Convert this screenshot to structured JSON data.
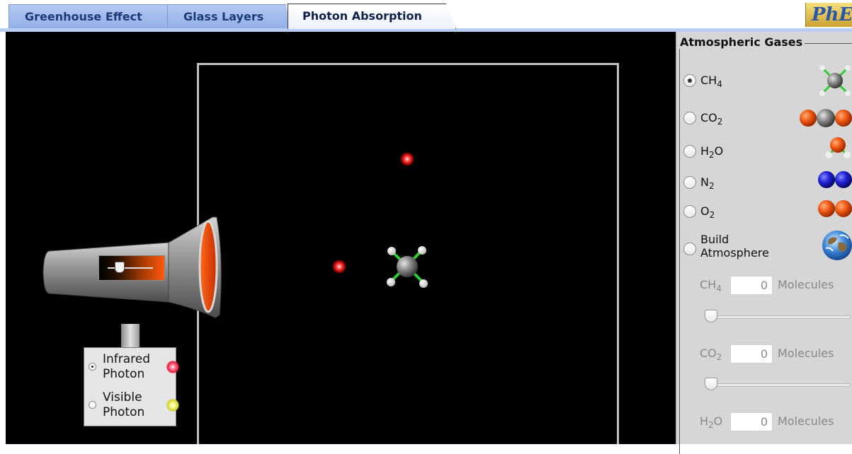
{
  "tabs": [
    {
      "label": "Greenhouse Effect",
      "active": false
    },
    {
      "label": "Glass Layers",
      "active": false
    },
    {
      "label": "Photon Absorption",
      "active": true
    }
  ],
  "logo": {
    "text": "PhET"
  },
  "emitter": {
    "intensity_level": 0.2,
    "photon_types": [
      {
        "label": "Infrared Photon",
        "selected": true,
        "icon": "infrared-photon-icon",
        "color": "#ff3a3a"
      },
      {
        "label": "Visible Photon",
        "selected": false,
        "icon": "visible-photon-icon",
        "color": "#e8e83a"
      }
    ]
  },
  "panel": {
    "title": "Atmospheric Gases",
    "gases": [
      {
        "formula": "CH",
        "sub": "4",
        "after": "",
        "selected": true,
        "icon": "methane-icon"
      },
      {
        "formula": "CO",
        "sub": "2",
        "after": "",
        "selected": false,
        "icon": "carbon-dioxide-icon"
      },
      {
        "formula": "H",
        "sub": "2",
        "after": "O",
        "selected": false,
        "icon": "water-icon"
      },
      {
        "formula": "N",
        "sub": "2",
        "after": "",
        "selected": false,
        "icon": "nitrogen-icon"
      },
      {
        "formula": "O",
        "sub": "2",
        "after": "",
        "selected": false,
        "icon": "oxygen-icon"
      },
      {
        "formula": "Build Atmosphere",
        "sub": "",
        "after": "",
        "selected": false,
        "icon": "earth-icon"
      }
    ],
    "molecule_counts": [
      {
        "formula": "CH",
        "sub": "4",
        "after": "",
        "value": "0",
        "unit": "Molecules",
        "slider_level": 0
      },
      {
        "formula": "CO",
        "sub": "2",
        "after": "",
        "value": "0",
        "unit": "Molecules",
        "slider_level": 0
      },
      {
        "formula": "H",
        "sub": "2",
        "after": "O",
        "value": "0",
        "unit": "Molecules"
      }
    ]
  },
  "colors": {
    "chamber_border": "#c0c0c0",
    "play_background": "#000000",
    "panel_background": "#d6d6d6",
    "tab_blue": "#b4c8f2"
  }
}
